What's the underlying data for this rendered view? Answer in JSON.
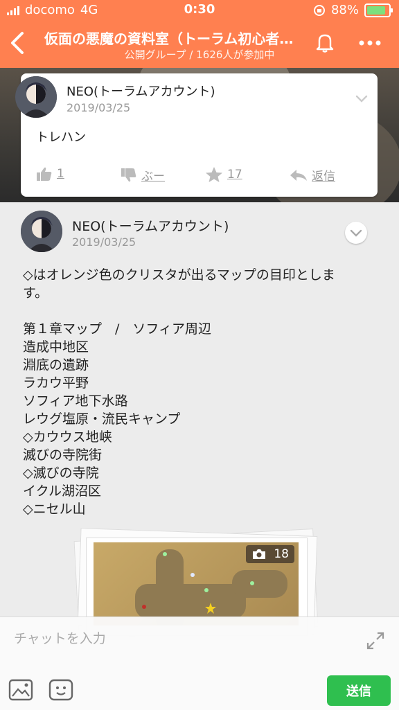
{
  "status": {
    "carrier": "docomo",
    "network": "4G",
    "time": "0:30",
    "battery": "88%",
    "battery_color": "#7ee07e"
  },
  "nav": {
    "title": "仮面の悪魔の資料室（トーラム初心者…",
    "subtitle": "公開グループ / 1626人が参加中",
    "accent": "#ff8050"
  },
  "reply_card": {
    "name": "NEO(トーラムアカウント)",
    "date": "2019/03/25",
    "text": "トレハン",
    "likes": "1",
    "dislike_label": "ぶー",
    "stars": "17",
    "reply_label": "返信"
  },
  "post": {
    "name": "NEO(トーラムアカウント)",
    "date": "2019/03/25",
    "lines": [
      "◇はオレンジ色のクリスタが出るマップの目印としま",
      "す。",
      "",
      "第１章マップ　/　ソフィア周辺",
      "造成中地区",
      "淵底の遺跡",
      "ラカウ平野",
      "ソフィア地下水路",
      "レウグ塩原・流民キャンプ",
      "◇カウウス地峡",
      "滅びの寺院街",
      "◇滅びの寺院",
      "イクル湖沼区",
      "◇ニセル山"
    ],
    "photo_count": "18"
  },
  "input": {
    "placeholder": "チャットを入力",
    "send_label": "送信",
    "send_color": "#2fbf4f"
  }
}
